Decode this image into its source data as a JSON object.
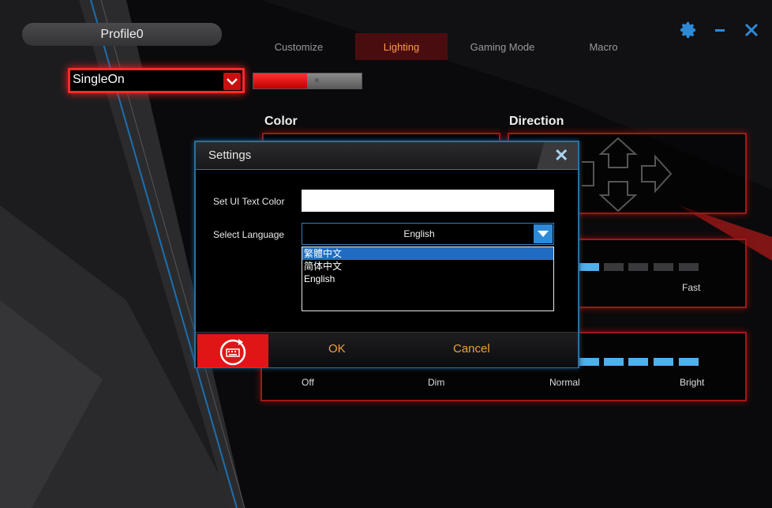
{
  "profile": {
    "name": "Profile0"
  },
  "tabs": [
    {
      "label": "Customize",
      "active": false
    },
    {
      "label": "Lighting",
      "active": true
    },
    {
      "label": "Gaming Mode",
      "active": false
    },
    {
      "label": "Macro",
      "active": false
    }
  ],
  "window_icons": [
    "gear-icon",
    "minimize-icon",
    "close-icon"
  ],
  "lighting": {
    "mode_value": "SingleOn",
    "toggle_state": "on",
    "color_label": "Color",
    "direction_label": "Direction",
    "speed": {
      "max_label": "Fast"
    },
    "brightness": {
      "labels": [
        "Off",
        "Dim",
        "Normal",
        "Bright"
      ]
    }
  },
  "settings_dialog": {
    "title": "Settings",
    "text_color_label": "Set UI Text Color",
    "language_label": "Select Language",
    "language_value": "English",
    "language_options": [
      {
        "label": "繁體中文",
        "highlighted": true
      },
      {
        "label": "简体中文",
        "highlighted": false
      },
      {
        "label": "English",
        "highlighted": false
      }
    ],
    "ok_label": "OK",
    "cancel_label": "Cancel"
  },
  "colors": {
    "accent_red": "#ff2a2a",
    "accent_blue": "#2e8ad8",
    "tab_active_text": "#ff9a4a",
    "button_text": "#f0a040"
  }
}
